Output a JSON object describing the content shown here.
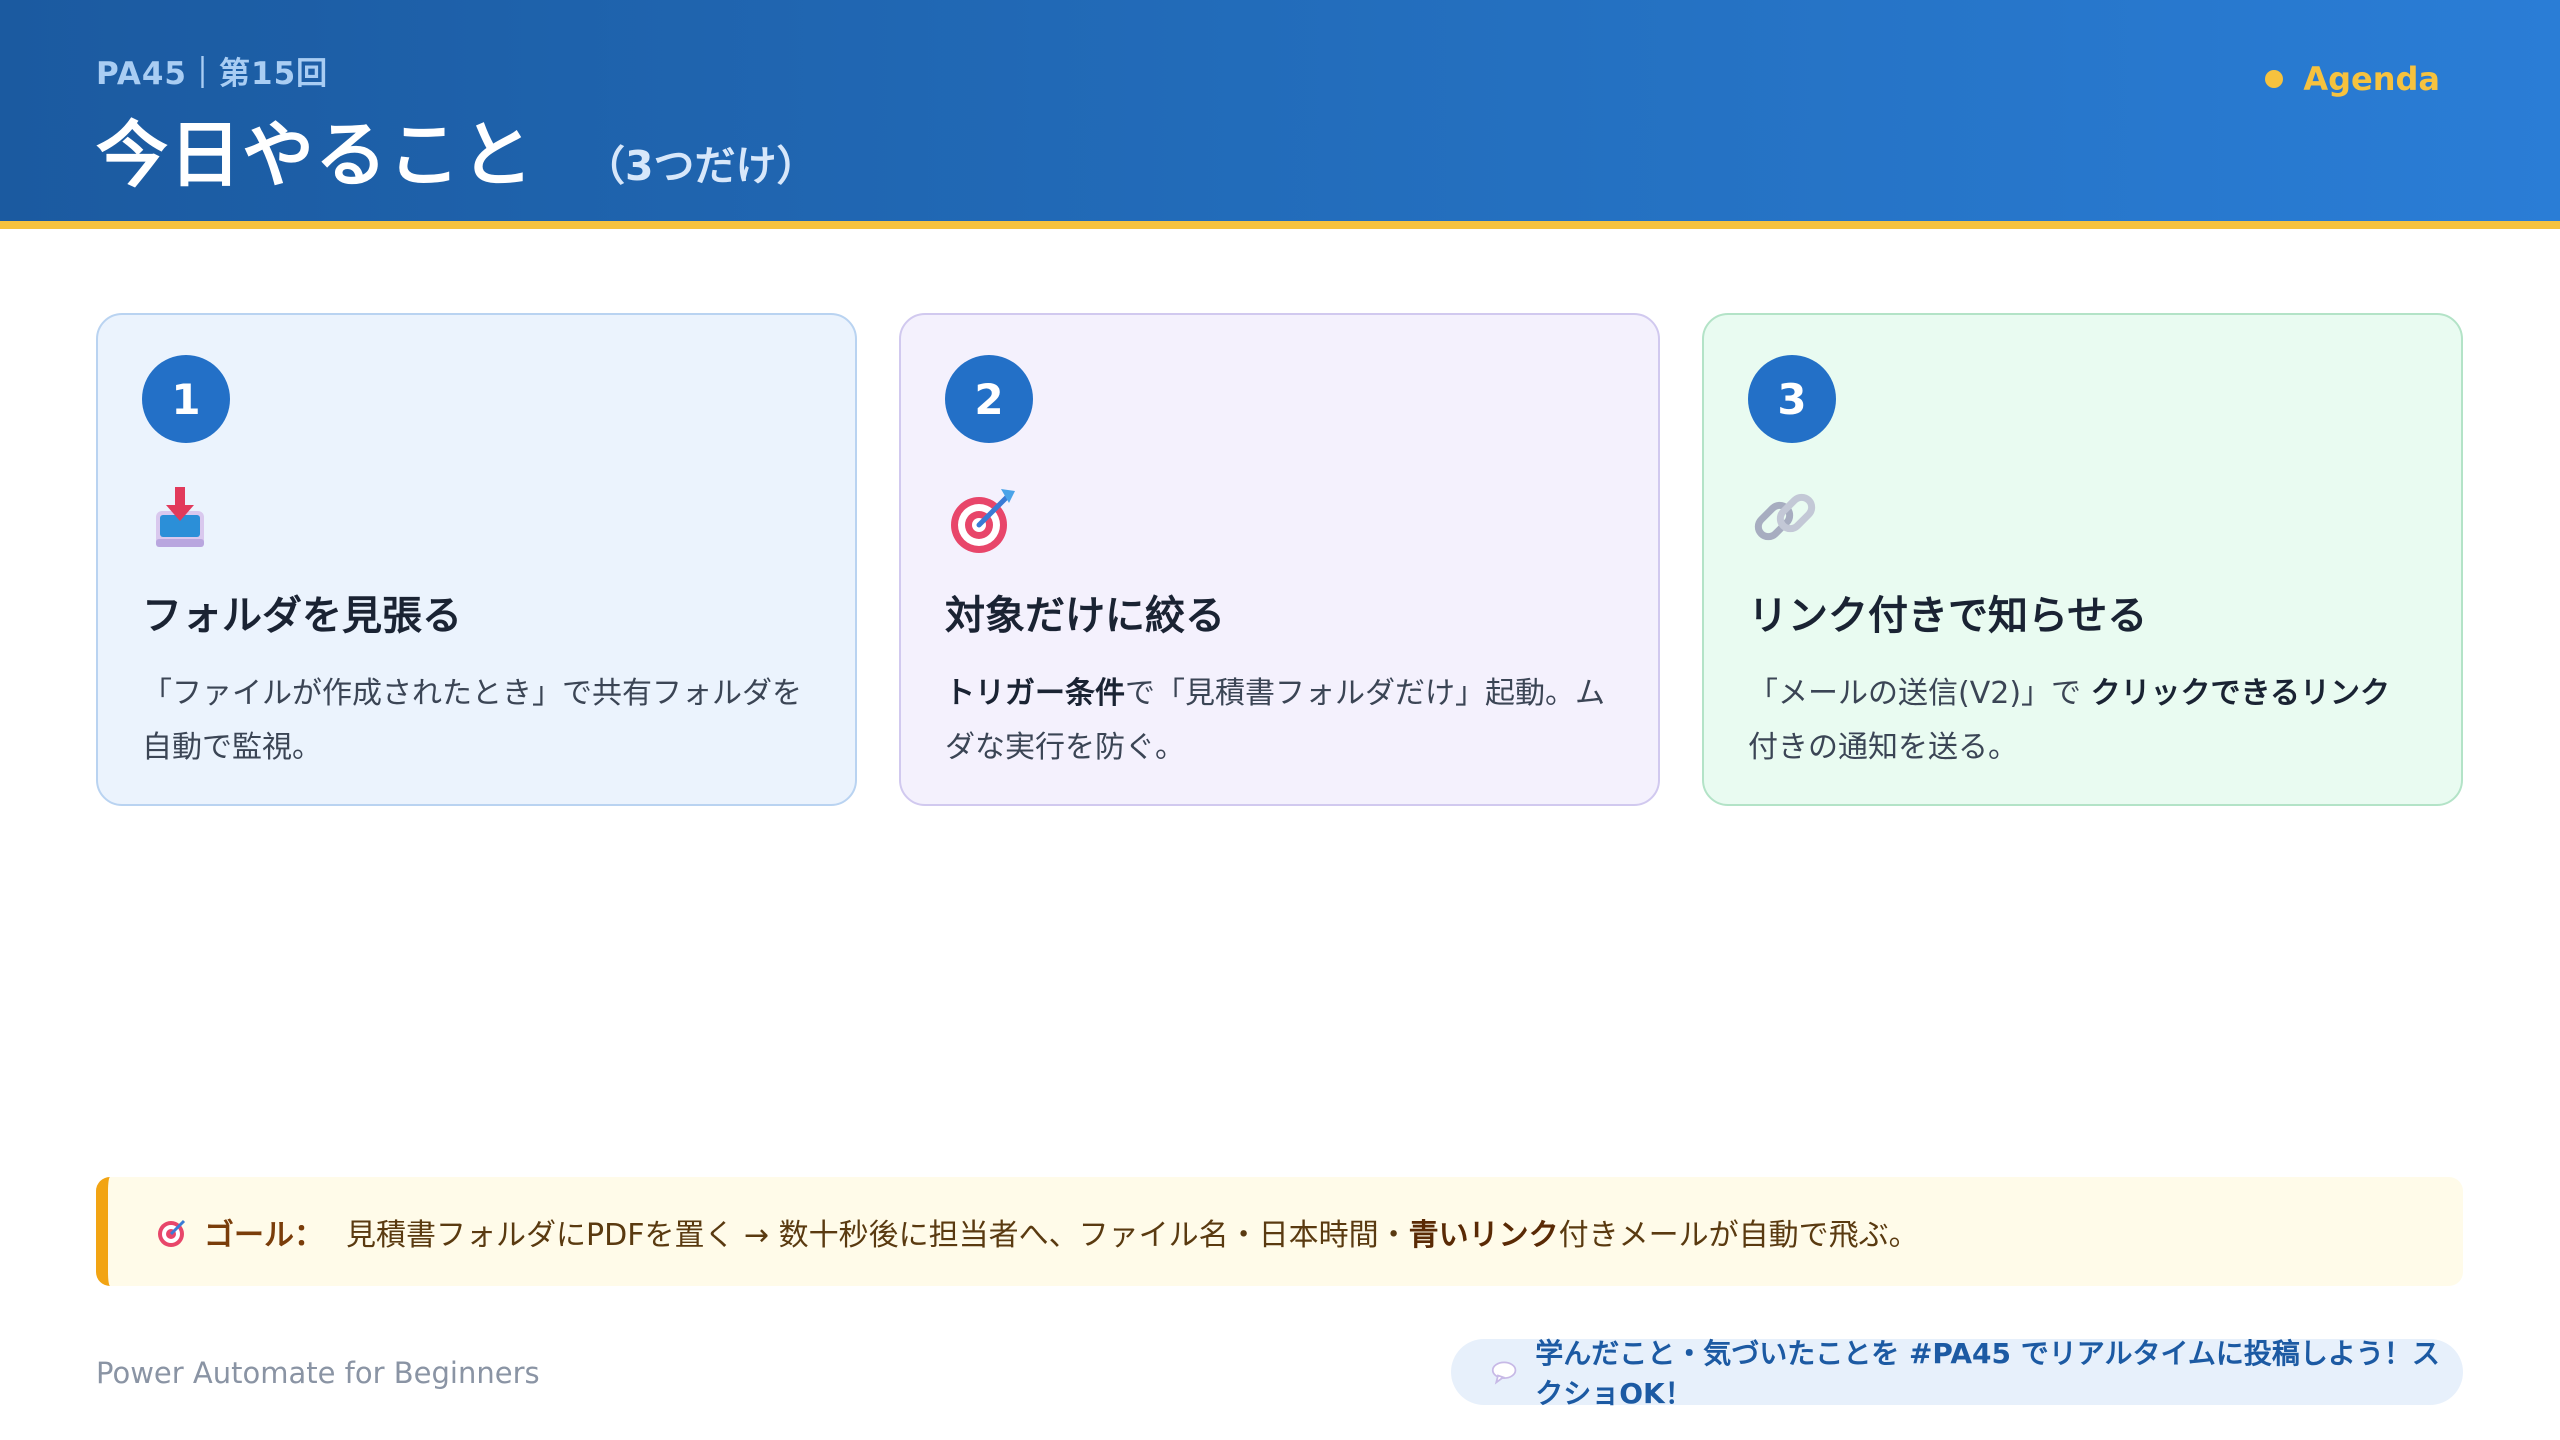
{
  "header": {
    "session": "PA45｜第15回",
    "title": "今日やること",
    "subtitle": "（3つだけ）",
    "agenda": "Agenda"
  },
  "cards": [
    {
      "number": "1",
      "icon": "inbox-tray-icon",
      "title": "フォルダを見張る",
      "desc": "「ファイルが作成されたとき」で共有フォルダを自動で監視。"
    },
    {
      "number": "2",
      "icon": "target-icon",
      "title": "対象だけに絞る",
      "desc_bold": "トリガー条件",
      "desc_rest": "で「見積書フォルダだけ」起動。ムダな実行を防ぐ。"
    },
    {
      "number": "3",
      "icon": "link-icon",
      "title": "リンク付きで知らせる",
      "desc_pre": "「メールの送信(V2)」で ",
      "desc_bold": "クリックできるリンク",
      "desc_post": "付きの通知を送る。"
    }
  ],
  "goal": {
    "icon": "target-icon",
    "label": "ゴール：",
    "text_pre": "見積書フォルダにPDFを置く → 数十秒後に担当者へ、ファイル名・日本時間・",
    "text_bold": "青いリンク",
    "text_post": "付きメールが自動で飛ぶ。"
  },
  "footer": {
    "left": "Power Automate for Beginners",
    "pill_icon": "speech-bubble-icon",
    "pill_text": "学んだこと・気づいたことを #PA45 でリアルタイムに投稿しよう！スクショOK！"
  },
  "colors": {
    "header_start": "#1b5aa0",
    "header_end": "#2a7dd6",
    "accent_yellow": "#f6c23e",
    "badge_blue": "#2370c7"
  }
}
